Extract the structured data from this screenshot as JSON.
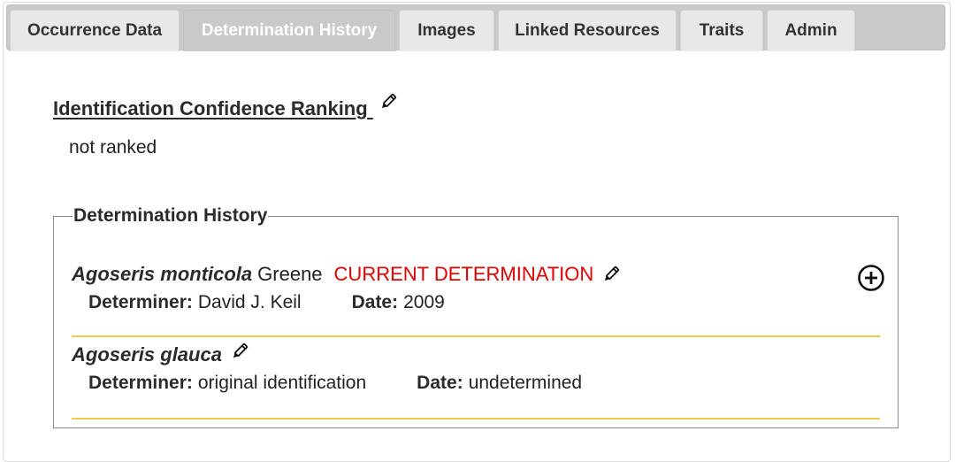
{
  "tabs": [
    {
      "label": "Occurrence Data",
      "active": false
    },
    {
      "label": "Determination History",
      "active": true
    },
    {
      "label": "Images",
      "active": false
    },
    {
      "label": "Linked Resources",
      "active": false
    },
    {
      "label": "Traits",
      "active": false
    },
    {
      "label": "Admin",
      "active": false
    }
  ],
  "confidence": {
    "title": "Identification Confidence Ranking",
    "value": "not ranked"
  },
  "history": {
    "legend": "Determination History",
    "determinations": [
      {
        "sciname": "Agoseris monticola",
        "author": "Greene",
        "current_label": "CURRENT DETERMINATION",
        "determiner_label": "Determiner:",
        "determiner": "David J. Keil",
        "date_label": "Date:",
        "date": "2009"
      },
      {
        "sciname": "Agoseris glauca",
        "author": "",
        "current_label": "",
        "determiner_label": "Determiner:",
        "determiner": "original identification",
        "date_label": "Date:",
        "date": "undetermined"
      }
    ]
  },
  "colors": {
    "current": "#e00000",
    "separator": "#f2c94c",
    "tab_active_bg": "#c9c9c9",
    "tab_bg": "#e8e8e8"
  },
  "icons": {
    "edit": "pencil-icon",
    "add": "plus-circle-icon"
  }
}
